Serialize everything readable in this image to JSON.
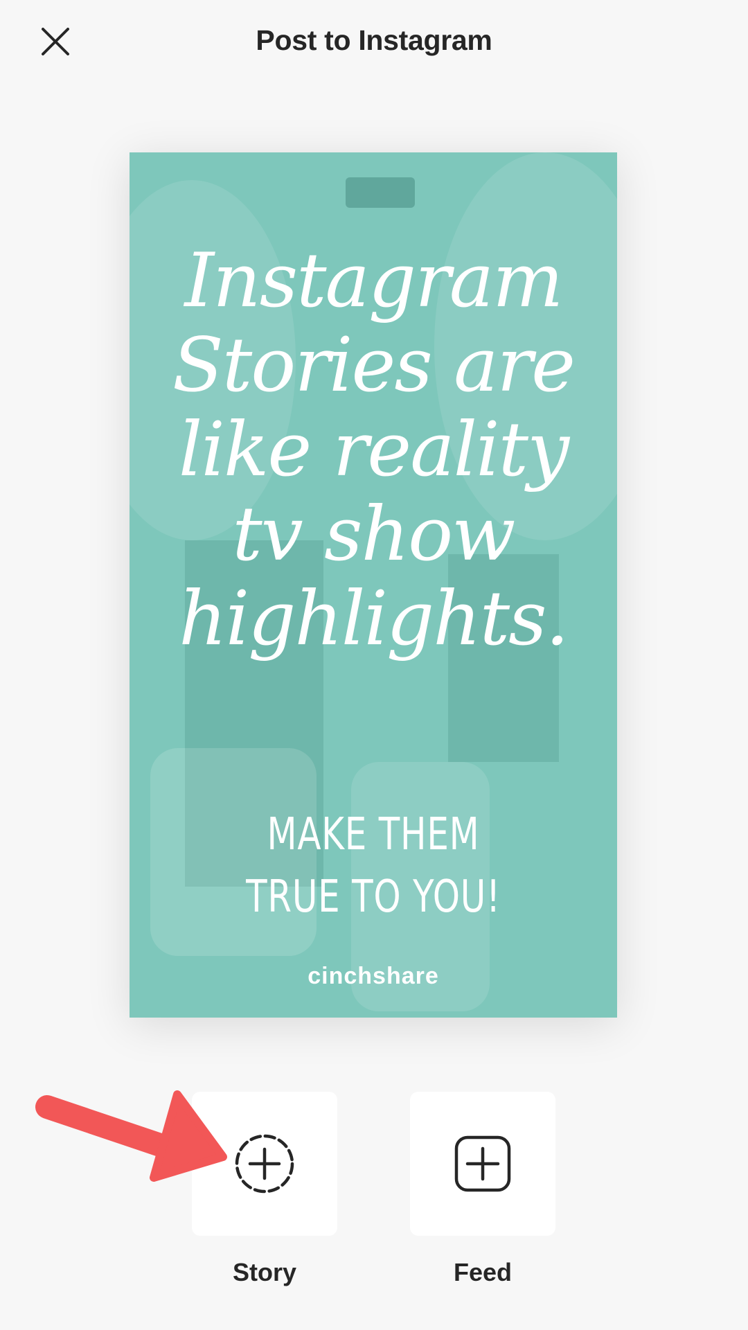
{
  "header": {
    "title": "Post to Instagram",
    "close_icon": "close-icon"
  },
  "preview": {
    "headline_lines": [
      "Instagram",
      "Stories are",
      "like reality",
      "tv show",
      "highlights."
    ],
    "subtext_lines": [
      "MAKE THEM",
      "TRUE TO YOU!"
    ],
    "brand": "cinchshare",
    "overlay_color": "#7ec7bb"
  },
  "options": {
    "story": {
      "label": "Story",
      "icon": "story-add-icon"
    },
    "feed": {
      "label": "Feed",
      "icon": "feed-add-icon"
    }
  },
  "annotation": {
    "arrow_color": "#f25757",
    "arrow_icon": "pointer-arrow-icon"
  }
}
